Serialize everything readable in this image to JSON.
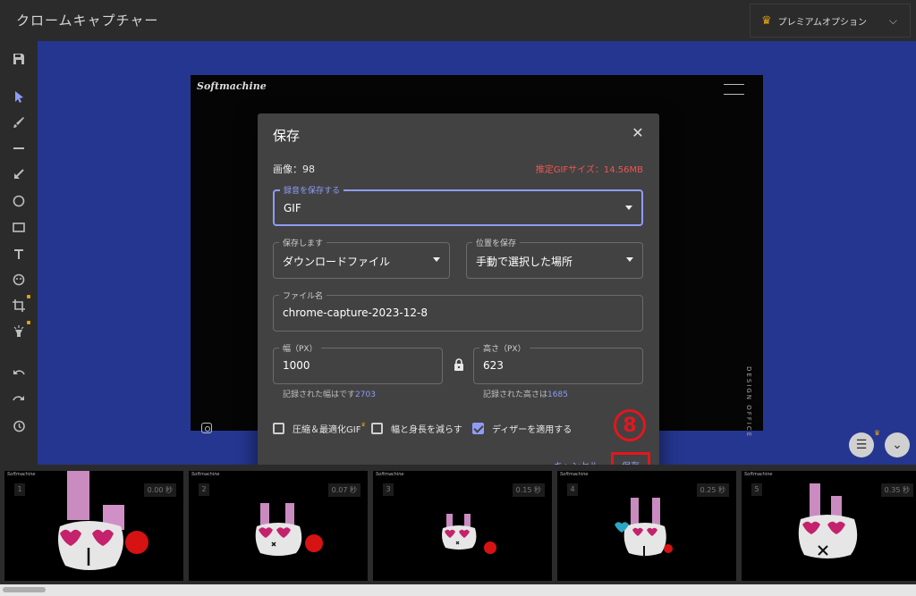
{
  "app": {
    "title": "クロームキャプチャー",
    "premium_label": "プレミアムオプション"
  },
  "canvas": {
    "brand": "Softmachine",
    "side_text": "DESIGN OFFICE"
  },
  "dialog": {
    "title": "保存",
    "image_count": "画像：98",
    "estimated_size": "推定GIFサイズ：14.56MB",
    "format": {
      "label": "録音を保存する",
      "value": "GIF"
    },
    "save_type": {
      "label": "保存します",
      "value": "ダウンロードファイル"
    },
    "save_location": {
      "label": "位置を保存",
      "value": "手動で選択した場所"
    },
    "filename": {
      "label": "ファイル名",
      "value": "chrome-capture-2023-12-8"
    },
    "width": {
      "label": "幅（PX）",
      "value": "1000",
      "helper": "記録された幅はです",
      "helper_value": "2703"
    },
    "height": {
      "label": "高さ（PX）",
      "value": "623",
      "helper": "記録された高さは",
      "helper_value": "1685"
    },
    "options": [
      {
        "label": "圧縮＆最適化GIF",
        "checked": false,
        "badge": "crown"
      },
      {
        "label": "幅と身長を減らす",
        "checked": false
      },
      {
        "label": "ディザーを適用する",
        "checked": true
      }
    ],
    "cancel_label": "キャンセル",
    "save_label": "保存",
    "step_marker": "8"
  },
  "frames": [
    {
      "index": "1",
      "time": "0.00 秒",
      "brand": "Softmachine"
    },
    {
      "index": "2",
      "time": "0.07 秒",
      "brand": "Softmachine"
    },
    {
      "index": "3",
      "time": "0.15 秒",
      "brand": "Softmachine"
    },
    {
      "index": "4",
      "time": "0.25 秒",
      "brand": "Softmachine"
    },
    {
      "index": "5",
      "time": "0.35 秒",
      "brand": "Softmachine"
    }
  ],
  "colors": {
    "accent": "#8e9cf5",
    "warning": "#f05454",
    "annotation_red": "#e4161d",
    "canvas_bg": "#253691"
  }
}
